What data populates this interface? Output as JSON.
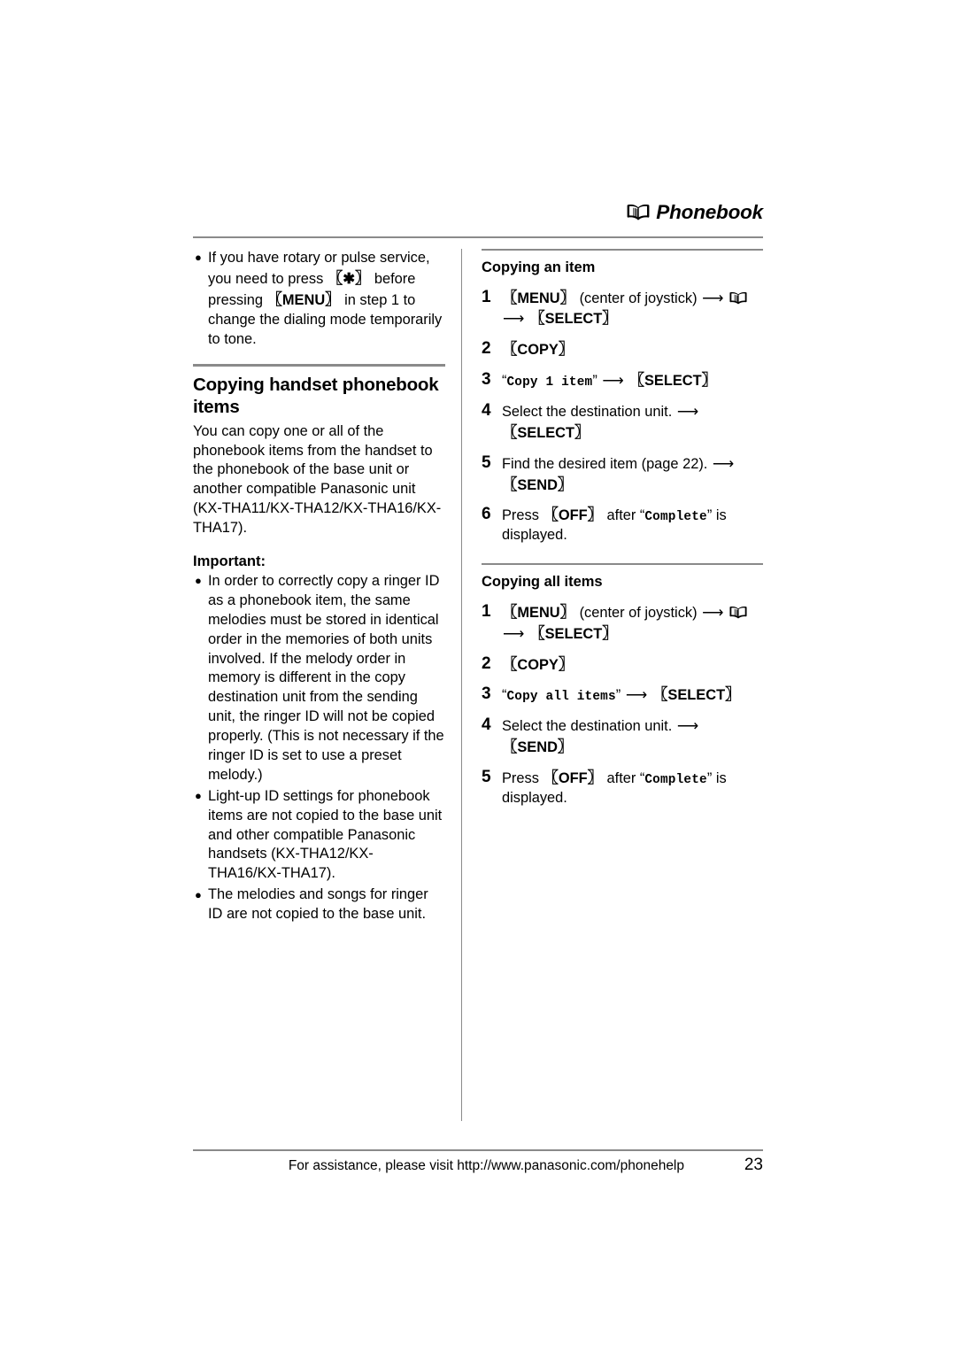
{
  "header": {
    "icon": "open-book-icon",
    "title": "Phonebook"
  },
  "left_column": {
    "top_notes": [
      {
        "parts": [
          {
            "t": "text",
            "v": "If you have rotary or pulse service, you need to press "
          },
          {
            "t": "key",
            "v": "✳"
          },
          {
            "t": "text",
            "v": " before pressing "
          },
          {
            "t": "key",
            "v": "MENU"
          },
          {
            "t": "text",
            "v": " in step 1 to change the dialing mode temporarily to tone."
          }
        ]
      }
    ],
    "section": {
      "title": "Copying handset phonebook items",
      "intro": "You can copy one or all of the phonebook items from the handset to the phonebook of the base unit or another compatible Panasonic unit (KX-THA11/KX-THA12/KX-THA16/KX-THA17).",
      "important_label": "Important:",
      "important_notes": [
        "In order to correctly copy a ringer ID as a phonebook item, the same melodies must be stored in identical order in the memories of both units involved.  If the melody order in memory is different in the copy destination unit from the sending unit, the ringer ID will not be copied properly.  (This is not necessary if the ringer ID is set to use a preset melody.)",
        "Light-up ID settings for phonebook items are not copied to the base unit and other compatible Panasonic handsets (KX-THA12/KX-THA16/KX-THA17).",
        "The melodies and songs for ringer ID are not copied to the base unit."
      ]
    }
  },
  "right_column": {
    "sections": [
      {
        "title": "Copying an item",
        "steps": [
          {
            "num": "1",
            "parts": [
              {
                "t": "key",
                "v": "MENU"
              },
              {
                "t": "text",
                "v": " (center of joystick) "
              },
              {
                "t": "arrow",
                "v": "→"
              },
              {
                "t": "icon",
                "v": "open-book-icon"
              },
              {
                "t": "br"
              },
              {
                "t": "arrow",
                "v": "→"
              },
              {
                "t": "key",
                "v": "SELECT"
              }
            ]
          },
          {
            "num": "2",
            "parts": [
              {
                "t": "key",
                "v": "COPY"
              }
            ]
          },
          {
            "num": "3",
            "parts": [
              {
                "t": "disp_q",
                "v": "Copy 1 item"
              },
              {
                "t": "arrow",
                "v": "→"
              },
              {
                "t": "key",
                "v": "SELECT"
              }
            ]
          },
          {
            "num": "4",
            "parts": [
              {
                "t": "text",
                "v": "Select the destination unit. "
              },
              {
                "t": "arrow",
                "v": "→"
              },
              {
                "t": "br"
              },
              {
                "t": "key",
                "v": "SELECT"
              }
            ]
          },
          {
            "num": "5",
            "parts": [
              {
                "t": "text",
                "v": "Find the desired item (page 22). "
              },
              {
                "t": "arrow",
                "v": "→"
              },
              {
                "t": "br"
              },
              {
                "t": "key",
                "v": "SEND"
              }
            ]
          },
          {
            "num": "6",
            "parts": [
              {
                "t": "text",
                "v": "Press "
              },
              {
                "t": "key",
                "v": "OFF"
              },
              {
                "t": "text",
                "v": " after "
              },
              {
                "t": "disp_q",
                "v": "Complete"
              },
              {
                "t": "text",
                "v": " is displayed."
              }
            ]
          }
        ]
      },
      {
        "title": "Copying all items",
        "steps": [
          {
            "num": "1",
            "parts": [
              {
                "t": "key",
                "v": "MENU"
              },
              {
                "t": "text",
                "v": " (center of joystick) "
              },
              {
                "t": "arrow",
                "v": "→"
              },
              {
                "t": "icon",
                "v": "open-book-icon"
              },
              {
                "t": "br"
              },
              {
                "t": "arrow",
                "v": "→"
              },
              {
                "t": "key",
                "v": "SELECT"
              }
            ]
          },
          {
            "num": "2",
            "parts": [
              {
                "t": "key",
                "v": "COPY"
              }
            ]
          },
          {
            "num": "3",
            "parts": [
              {
                "t": "disp_q",
                "v": "Copy all items"
              },
              {
                "t": "arrow",
                "v": "→"
              },
              {
                "t": "key",
                "v": "SELECT"
              }
            ]
          },
          {
            "num": "4",
            "parts": [
              {
                "t": "text",
                "v": "Select the destination unit. "
              },
              {
                "t": "arrow",
                "v": "→"
              },
              {
                "t": "key",
                "v": "SEND"
              }
            ]
          },
          {
            "num": "5",
            "parts": [
              {
                "t": "text",
                "v": "Press "
              },
              {
                "t": "key",
                "v": "OFF"
              },
              {
                "t": "text",
                "v": " after "
              },
              {
                "t": "disp_q",
                "v": "Complete"
              },
              {
                "t": "text",
                "v": " is displayed."
              }
            ]
          }
        ]
      }
    ]
  },
  "footer": {
    "text": "For assistance, please visit http://www.panasonic.com/phonehelp",
    "page_number": "23"
  },
  "colors": {
    "rule": "#8a8a8a",
    "text": "#000000",
    "background": "#ffffff"
  }
}
